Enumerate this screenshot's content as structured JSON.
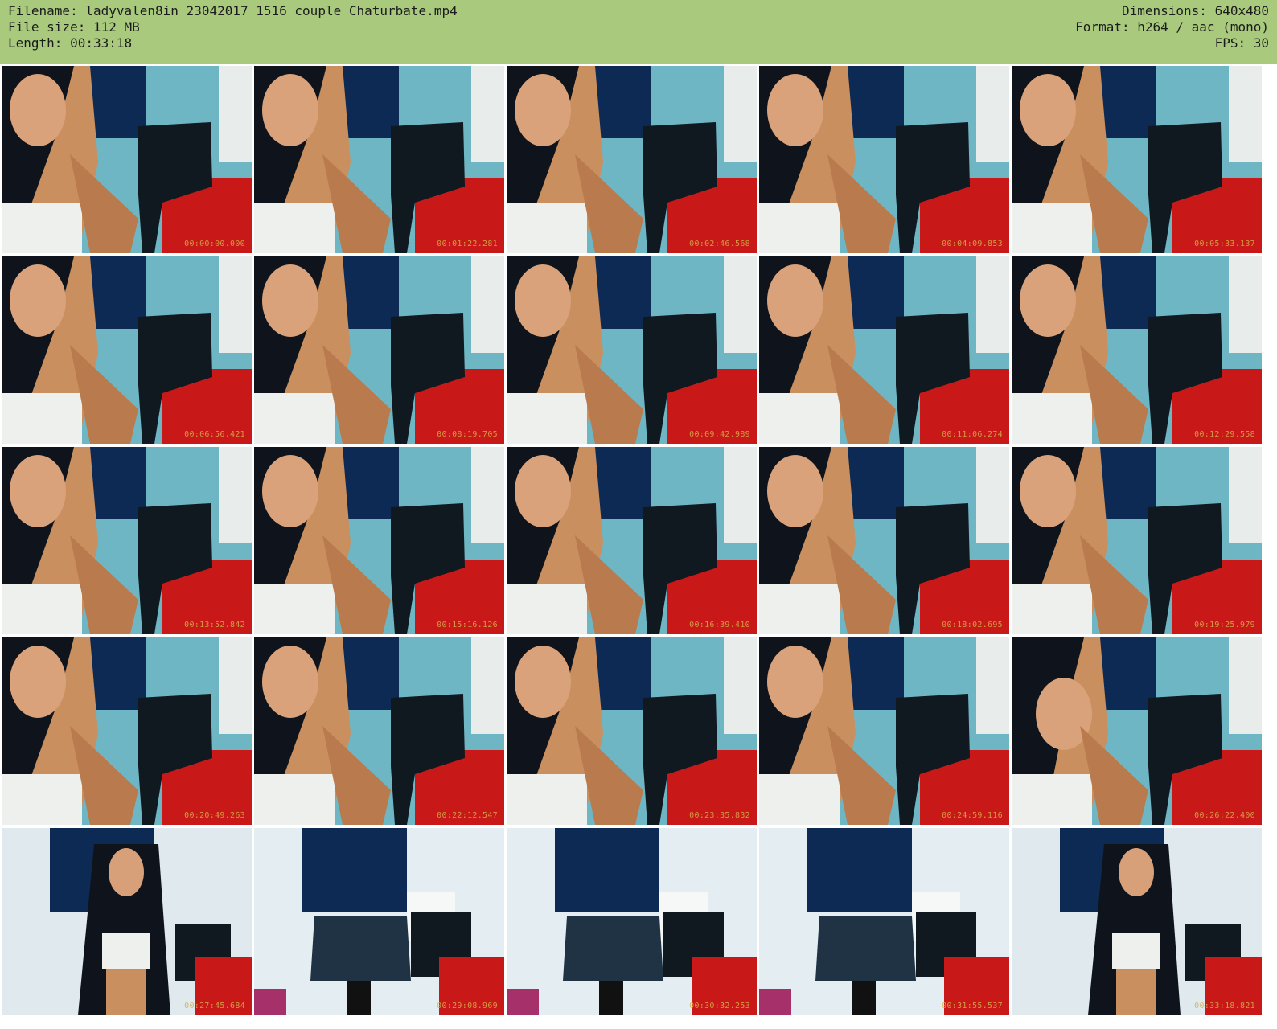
{
  "header": {
    "filename": "Filename: ladyvalen8in_23042017_1516_couple_Chaturbate.mp4",
    "filesize": "File size: 112 MB",
    "length": "Length: 00:33:18",
    "dimensions": "Dimensions: 640x480",
    "format": "Format: h264 / aac (mono)",
    "fps": "FPS: 30"
  },
  "thumbnails": [
    {
      "timestamp": "00:00:00.000",
      "scene": "closeup"
    },
    {
      "timestamp": "00:01:22.281",
      "scene": "closeup"
    },
    {
      "timestamp": "00:02:46.568",
      "scene": "closeup"
    },
    {
      "timestamp": "00:04:09.853",
      "scene": "closeup"
    },
    {
      "timestamp": "00:05:33.137",
      "scene": "closeup"
    },
    {
      "timestamp": "00:06:56.421",
      "scene": "closeup"
    },
    {
      "timestamp": "00:08:19.705",
      "scene": "closeup"
    },
    {
      "timestamp": "00:09:42.989",
      "scene": "closeup"
    },
    {
      "timestamp": "00:11:06.274",
      "scene": "closeup"
    },
    {
      "timestamp": "00:12:29.558",
      "scene": "closeup"
    },
    {
      "timestamp": "00:13:52.842",
      "scene": "closeup"
    },
    {
      "timestamp": "00:15:16.126",
      "scene": "closeup"
    },
    {
      "timestamp": "00:16:39.410",
      "scene": "closeup"
    },
    {
      "timestamp": "00:18:02.695",
      "scene": "closeup"
    },
    {
      "timestamp": "00:19:25.979",
      "scene": "closeup"
    },
    {
      "timestamp": "00:20:49.263",
      "scene": "closeup"
    },
    {
      "timestamp": "00:22:12.547",
      "scene": "closeup"
    },
    {
      "timestamp": "00:23:35.832",
      "scene": "closeup"
    },
    {
      "timestamp": "00:24:59.116",
      "scene": "closeup"
    },
    {
      "timestamp": "00:26:22.400",
      "scene": "closeup-profile"
    },
    {
      "timestamp": "00:27:45.684",
      "scene": "wide-person"
    },
    {
      "timestamp": "00:29:08.969",
      "scene": "wide-chair"
    },
    {
      "timestamp": "00:30:32.253",
      "scene": "wide-chair"
    },
    {
      "timestamp": "00:31:55.537",
      "scene": "wide-chair"
    },
    {
      "timestamp": "00:33:18.821",
      "scene": "wide-person"
    }
  ],
  "colors": {
    "header_bg": "#a9c97d",
    "wall": "#6fb6c4",
    "desk": "#c81818",
    "chair": "#101820",
    "poster": "#0d2a55",
    "timestamp": "#d6b24a"
  }
}
